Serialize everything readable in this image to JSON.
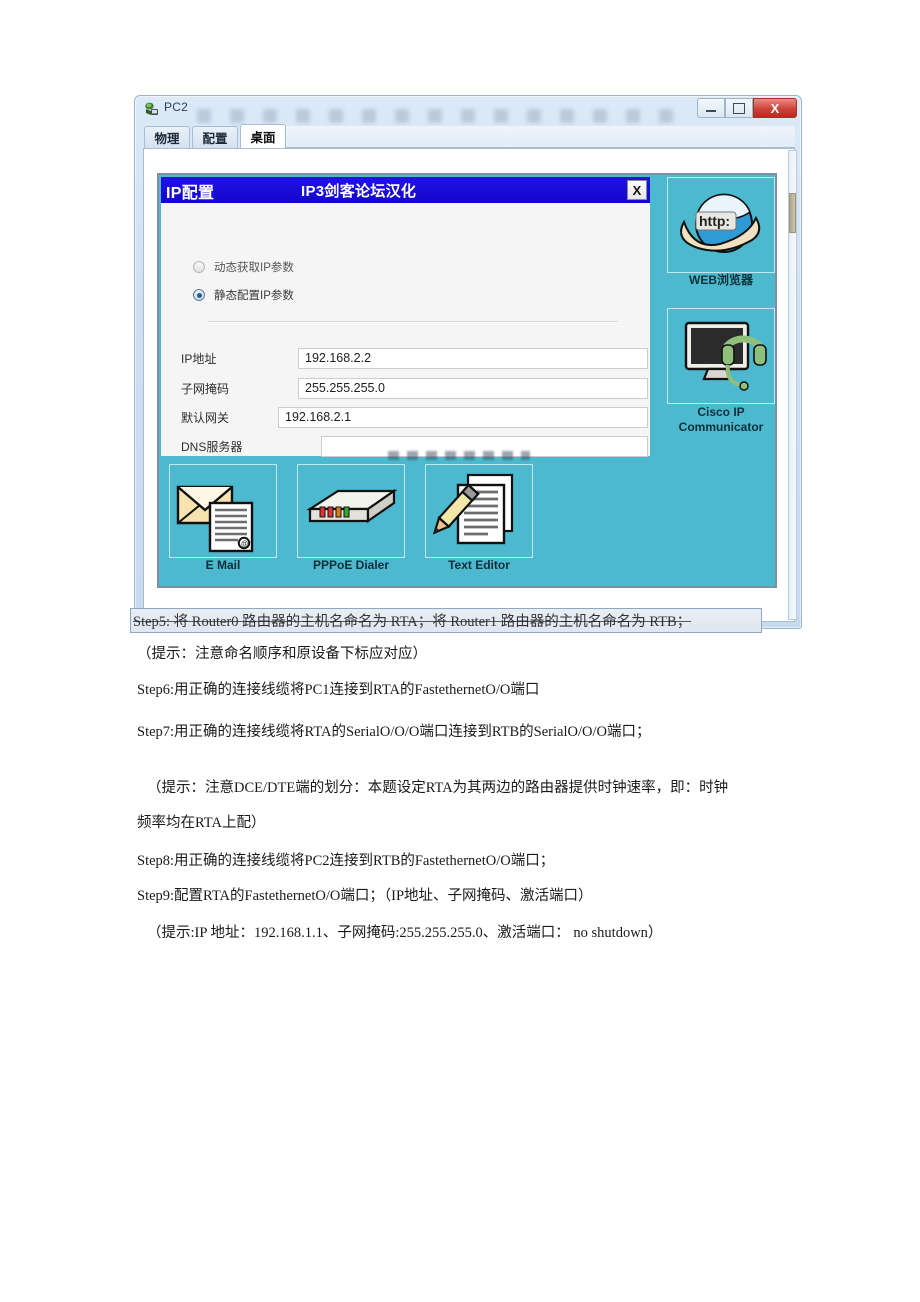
{
  "window": {
    "title": "PC2",
    "icon": "packet-tracer-pc-icon",
    "buttons": {
      "minimize": "",
      "maximize": "",
      "close": "X"
    },
    "tabs": [
      {
        "label": "物理",
        "active": false
      },
      {
        "label": "配置",
        "active": false
      },
      {
        "label": "桌面",
        "active": true
      }
    ]
  },
  "dialog": {
    "title": "IP配置",
    "subtitle": "IP3剑客论坛汉化",
    "close_label": "X",
    "radios": [
      {
        "label": "动态获取IP参数",
        "checked": false
      },
      {
        "label": "静态配置IP参数",
        "checked": true
      }
    ],
    "fields": [
      {
        "label": "IP地址",
        "value": "192.168.2.2"
      },
      {
        "label": "子网掩码",
        "value": "255.255.255.0"
      },
      {
        "label": "默认网关",
        "value": "192.168.2.1"
      },
      {
        "label": "DNS服务器",
        "value": ""
      }
    ]
  },
  "desktop": {
    "background_color": "#4cb9cf",
    "items": [
      {
        "name": "e-mail",
        "caption": "E Mail",
        "icon": "envelope-document-icon"
      },
      {
        "name": "pppoe-dialer",
        "caption": "PPPoE Dialer",
        "icon": "modem-icon"
      },
      {
        "name": "text-editor",
        "caption": "Text Editor",
        "icon": "pencil-document-icon"
      },
      {
        "name": "web-browser",
        "caption": "WEB浏览器",
        "icon": "globe-http-icon"
      },
      {
        "name": "cisco-ip-comm",
        "caption": "Cisco IP\nCommunicator",
        "icon": "monitor-headset-icon"
      }
    ],
    "cisco_caption_line1": "Cisco IP",
    "cisco_caption_line2": "Communicator"
  },
  "document": {
    "step5": "Step5: 将 Router0 路由器的主机名命名为 RTA；将 Router1 路由器的主机名命名为 RTB；",
    "hint5": "（提示：注意命名顺序和原设备下标应对应）",
    "step6": "Step6:用正确的连接线缆将PC1连接到RTA的FastethernetO/O端口",
    "step7": "Step7:用正确的连接线缆将RTA的SerialO/O/O端口连接到RTB的SerialO/O/O端口；",
    "hint7_line1": "（提示：注意DCE/DTE端的划分：本题设定RTA为其两边的路由器提供时钟速率，即：时钟",
    "hint7_line2": "频率均在RTA上配）",
    "step8": "Step8:用正确的连接线缆将PC2连接到RTB的FastethernetO/O端口；",
    "step9": "Step9:配置RTA的FastethernetO/O端口；（IP地址、子网掩码、激活端口）",
    "hint9": "（提示:IP 地址：192.168.1.1、子网掩码:255.255.255.0、激活端口： no shutdown）"
  }
}
